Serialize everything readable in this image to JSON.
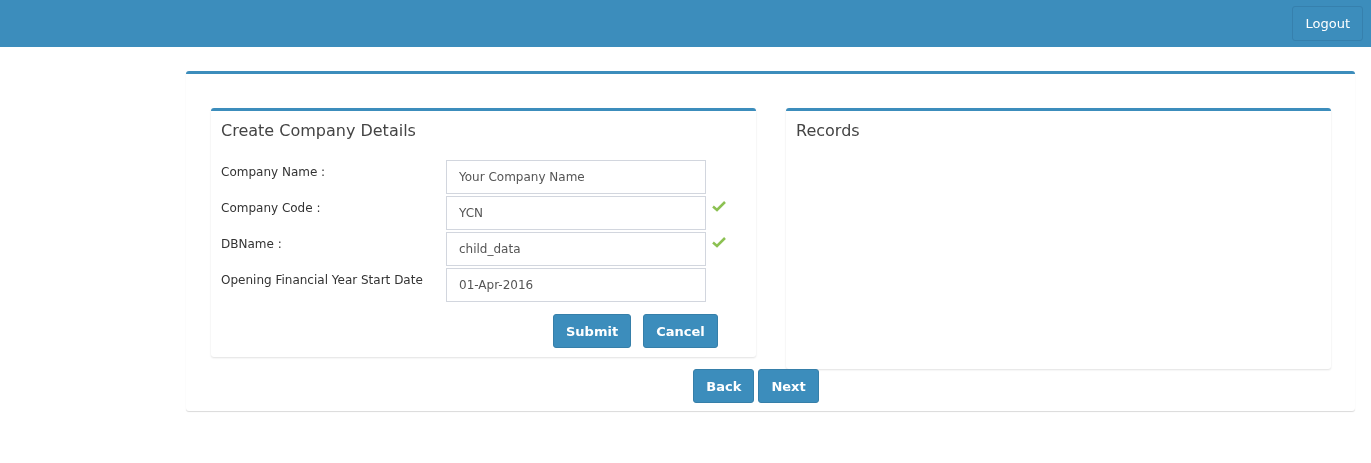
{
  "header": {
    "logout": "Logout"
  },
  "form": {
    "title": "Create Company Details",
    "fields": [
      {
        "label": "Company Name :",
        "value": "Your Company Name",
        "valid": false
      },
      {
        "label": "Company Code :",
        "value": "YCN",
        "valid": true
      },
      {
        "label": "DBName :",
        "value": "child_data",
        "valid": true
      },
      {
        "label": "Opening Financial Year Start Date",
        "value": "01-Apr-2016",
        "valid": false
      }
    ],
    "buttons": [
      "Submit",
      "Cancel"
    ]
  },
  "records": {
    "title": "Records"
  },
  "nav": [
    "Back",
    "Next"
  ]
}
